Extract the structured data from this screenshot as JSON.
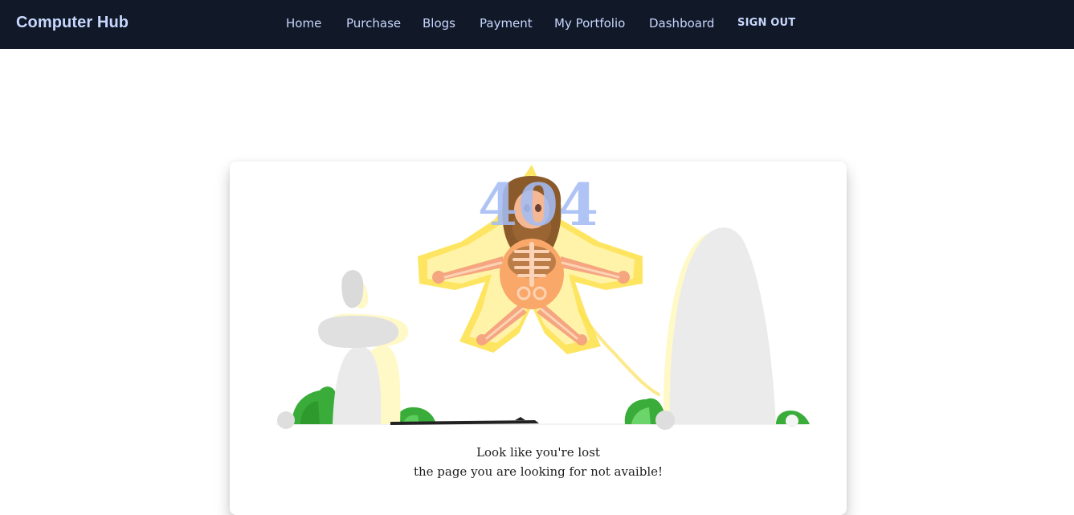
{
  "nav": {
    "brand": "Computer Hub",
    "links": [
      "Home",
      "Purchase",
      "Blogs",
      "Payment",
      "My Portfolio",
      "Dashboard"
    ],
    "signout": "SIGN OUT"
  },
  "error": {
    "code": "404",
    "line1": "Look like you're lost",
    "line2": "the page you are looking for not avaible!"
  },
  "colors": {
    "navbar_bg": "#111827",
    "nav_text": "#c7d7fe",
    "code_text": "#a4bcf4"
  },
  "icons": {
    "illustration": "skeleton-electrocuted-illustration"
  }
}
